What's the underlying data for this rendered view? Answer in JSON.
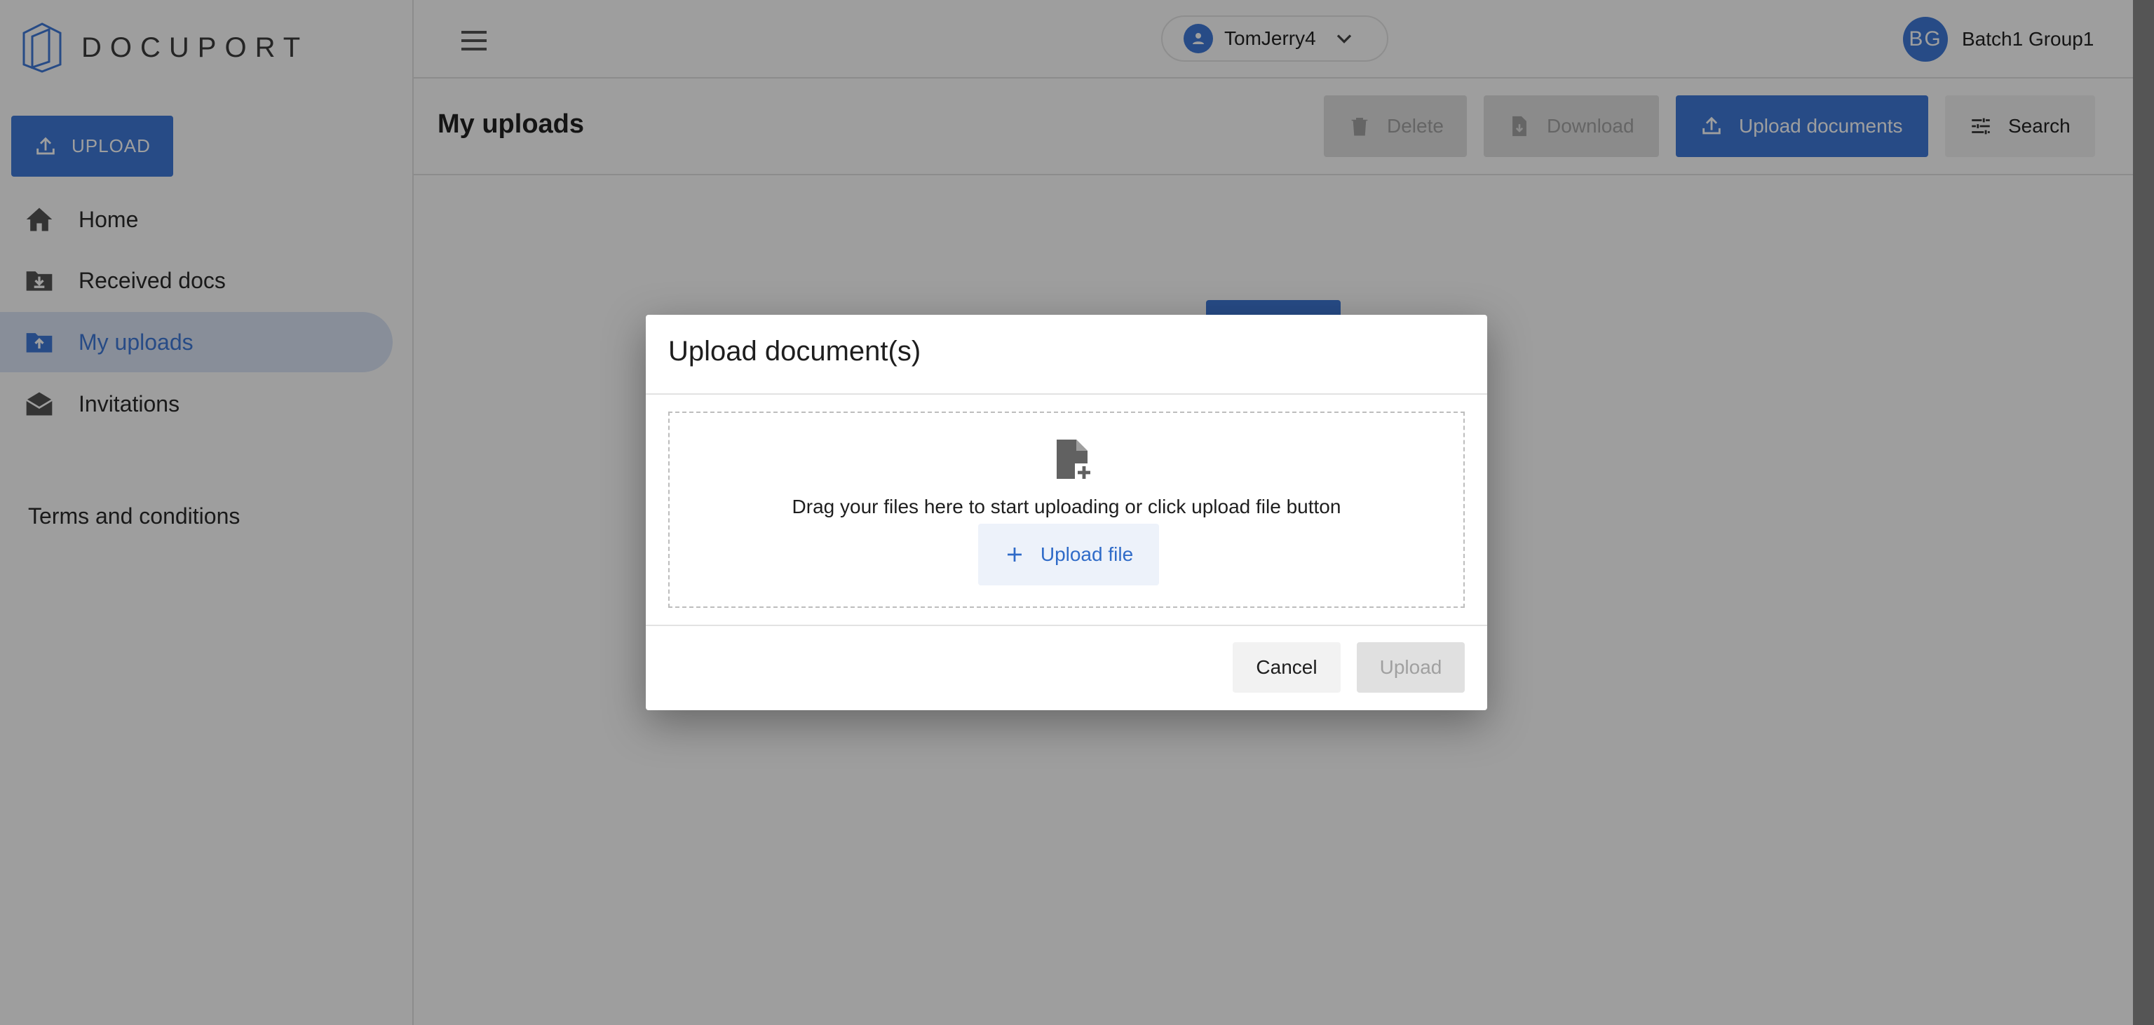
{
  "app": {
    "logo_text": "DOCUPORT",
    "accent_color": "#3f7ad9"
  },
  "sidebar": {
    "upload_button": {
      "label": "UPLOAD",
      "icon": "upload-icon"
    },
    "items": [
      {
        "label": "Home",
        "icon": "home-icon",
        "active": false
      },
      {
        "label": "Received docs",
        "icon": "folder-download-icon",
        "active": false
      },
      {
        "label": "My uploads",
        "icon": "folder-upload-icon",
        "active": true
      },
      {
        "label": "Invitations",
        "icon": "envelope-open-icon",
        "active": false
      }
    ],
    "terms_link": "Terms and conditions"
  },
  "topbar": {
    "menu_icon": "hamburger-icon",
    "user_selector": {
      "value": "TomJerry4",
      "icon": "person-icon"
    },
    "profile": {
      "initials": "BG",
      "name": "Batch1 Group1"
    }
  },
  "page": {
    "title": "My uploads",
    "actions": {
      "delete": "Delete",
      "download": "Download",
      "upload_documents": "Upload documents",
      "search": "Search"
    }
  },
  "modal": {
    "title": "Upload document(s)",
    "drop_text": "Drag your files here to start uploading or click upload file button",
    "upload_file_button": "Upload file",
    "cancel_button": "Cancel",
    "upload_button": "Upload"
  }
}
